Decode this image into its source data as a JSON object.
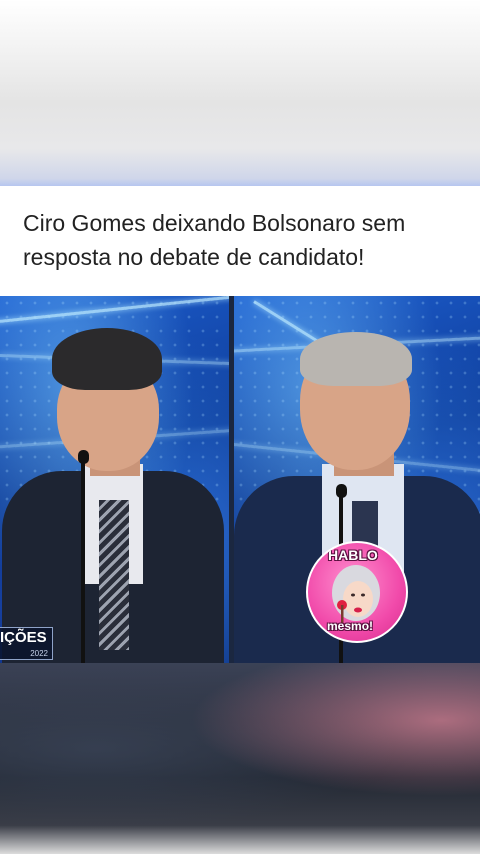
{
  "post": {
    "caption": "Ciro Gomes deixando Bolsonaro sem resposta no debate de candidato!"
  },
  "video": {
    "broadcast_logo": {
      "title": "IÇÕES",
      "year": "2022"
    },
    "watermark": {
      "top_text": "HABLO",
      "bottom_text": "mesmo!"
    }
  },
  "colors": {
    "background_blue": "#1d5fd0",
    "badge_pink": "#f14aaa"
  }
}
